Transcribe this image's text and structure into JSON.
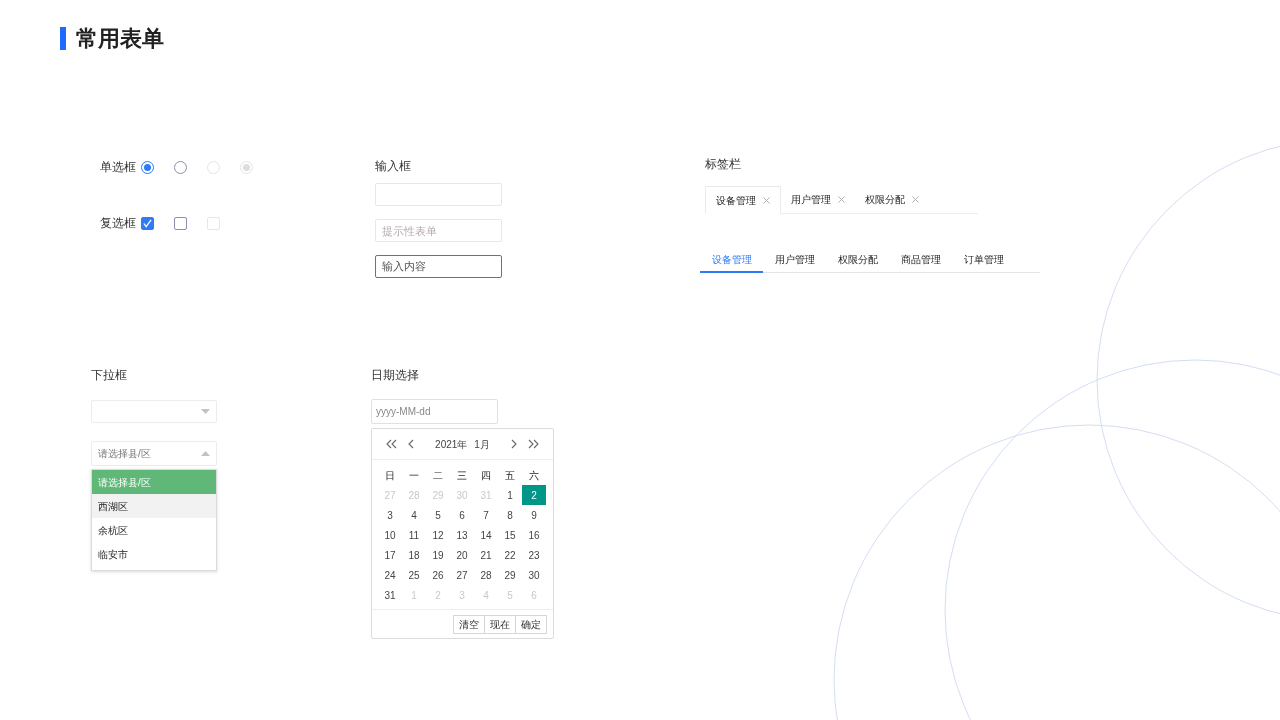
{
  "title": "常用表单",
  "radio": {
    "label": "单选框",
    "items": [
      {
        "checked": true,
        "disabled": false
      },
      {
        "checked": false,
        "disabled": false
      },
      {
        "checked": false,
        "disabled": true
      },
      {
        "checked": true,
        "disabled": true
      }
    ]
  },
  "checkbox": {
    "label": "复选框",
    "items": [
      {
        "checked": true,
        "disabled": false
      },
      {
        "checked": false,
        "disabled": false
      },
      {
        "checked": false,
        "disabled": true
      }
    ]
  },
  "inputs": {
    "label": "输入框",
    "fields": [
      {
        "focused": false
      },
      {
        "placeholder": "提示性表单",
        "focused": false
      },
      {
        "value": "输入内容",
        "focused": true
      }
    ]
  },
  "tabbar": {
    "label": "标签栏",
    "card_tabs": [
      {
        "label": "设备管理",
        "selected": true
      },
      {
        "label": "用户管理",
        "selected": false
      },
      {
        "label": "权限分配",
        "selected": false
      }
    ],
    "line_tabs": [
      {
        "label": "设备管理",
        "selected": true
      },
      {
        "label": "用户管理",
        "selected": false
      },
      {
        "label": "权限分配",
        "selected": false
      },
      {
        "label": "商品管理",
        "selected": false
      },
      {
        "label": "订单管理",
        "selected": false
      }
    ]
  },
  "dropdown": {
    "label": "下拉框",
    "selects": [
      {
        "expanded": false
      },
      {
        "value": "请选择县/区",
        "expanded": true
      }
    ],
    "options": [
      {
        "label": "请选择县/区",
        "selected": true,
        "hovered": false
      },
      {
        "label": "西湖区",
        "selected": false,
        "hovered": true
      },
      {
        "label": "余杭区",
        "selected": false,
        "hovered": false
      },
      {
        "label": "临安市",
        "selected": false,
        "hovered": false
      }
    ]
  },
  "date": {
    "label": "日期选择",
    "placeholder": "yyyy-MM-dd",
    "year": "2021年",
    "month": "1月",
    "weekdays": [
      "日",
      "一",
      "二",
      "三",
      "四",
      "五",
      "六"
    ],
    "weeks": [
      [
        {
          "d": "27",
          "outside": true,
          "selected": false
        },
        {
          "d": "28",
          "outside": true,
          "selected": false
        },
        {
          "d": "29",
          "outside": true,
          "selected": false
        },
        {
          "d": "30",
          "outside": true,
          "selected": false
        },
        {
          "d": "31",
          "outside": true,
          "selected": false
        },
        {
          "d": "1",
          "outside": false,
          "selected": false
        },
        {
          "d": "2",
          "outside": false,
          "selected": true
        }
      ],
      [
        {
          "d": "3",
          "outside": false,
          "selected": false
        },
        {
          "d": "4",
          "outside": false,
          "selected": false
        },
        {
          "d": "5",
          "outside": false,
          "selected": false
        },
        {
          "d": "6",
          "outside": false,
          "selected": false
        },
        {
          "d": "7",
          "outside": false,
          "selected": false
        },
        {
          "d": "8",
          "outside": false,
          "selected": false
        },
        {
          "d": "9",
          "outside": false,
          "selected": false
        }
      ],
      [
        {
          "d": "10",
          "outside": false,
          "selected": false
        },
        {
          "d": "11",
          "outside": false,
          "selected": false
        },
        {
          "d": "12",
          "outside": false,
          "selected": false
        },
        {
          "d": "13",
          "outside": false,
          "selected": false
        },
        {
          "d": "14",
          "outside": false,
          "selected": false
        },
        {
          "d": "15",
          "outside": false,
          "selected": false
        },
        {
          "d": "16",
          "outside": false,
          "selected": false
        }
      ],
      [
        {
          "d": "17",
          "outside": false,
          "selected": false
        },
        {
          "d": "18",
          "outside": false,
          "selected": false
        },
        {
          "d": "19",
          "outside": false,
          "selected": false
        },
        {
          "d": "20",
          "outside": false,
          "selected": false
        },
        {
          "d": "21",
          "outside": false,
          "selected": false
        },
        {
          "d": "22",
          "outside": false,
          "selected": false
        },
        {
          "d": "23",
          "outside": false,
          "selected": false
        }
      ],
      [
        {
          "d": "24",
          "outside": false,
          "selected": false
        },
        {
          "d": "25",
          "outside": false,
          "selected": false
        },
        {
          "d": "26",
          "outside": false,
          "selected": false
        },
        {
          "d": "27",
          "outside": false,
          "selected": false
        },
        {
          "d": "28",
          "outside": false,
          "selected": false
        },
        {
          "d": "29",
          "outside": false,
          "selected": false
        },
        {
          "d": "30",
          "outside": false,
          "selected": false
        }
      ],
      [
        {
          "d": "31",
          "outside": false,
          "selected": false
        },
        {
          "d": "1",
          "outside": true,
          "selected": false
        },
        {
          "d": "2",
          "outside": true,
          "selected": false
        },
        {
          "d": "3",
          "outside": true,
          "selected": false
        },
        {
          "d": "4",
          "outside": true,
          "selected": false
        },
        {
          "d": "5",
          "outside": true,
          "selected": false
        },
        {
          "d": "6",
          "outside": true,
          "selected": false
        }
      ]
    ],
    "buttons": [
      "清空",
      "现在",
      "确定"
    ]
  }
}
